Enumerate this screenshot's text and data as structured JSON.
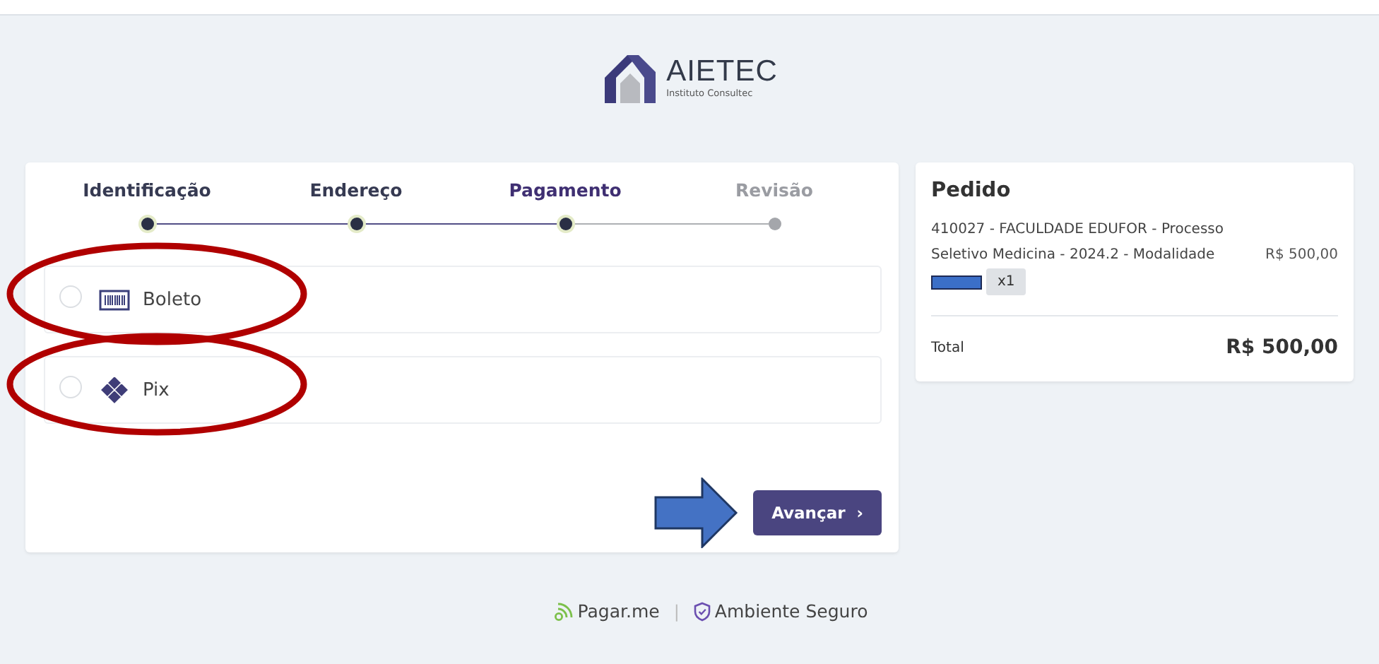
{
  "logo": {
    "name": "AIETEC",
    "tagline": "Instituto Consultec"
  },
  "steps": [
    {
      "label": "Identificação",
      "completed": true,
      "selected": false
    },
    {
      "label": "Endereço",
      "completed": true,
      "selected": false
    },
    {
      "label": "Pagamento",
      "completed": false,
      "selected": true
    },
    {
      "label": "Revisão",
      "completed": false,
      "selected": false
    }
  ],
  "payment_options": [
    {
      "label": "Boleto",
      "kind": "barcode",
      "selected": false,
      "circled": true
    },
    {
      "label": "Pix",
      "kind": "pix",
      "selected": false,
      "circled": true
    }
  ],
  "next_button": {
    "label": "Avançar",
    "chevron": "›",
    "arrow_pointer": true
  },
  "order": {
    "title": "Pedido",
    "items": [
      {
        "line1": "410027 - FACULDADE EDUFOR - Processo",
        "line2": "Seletivo Medicina - 2024.2 - Modalidade",
        "price": "R$ 500,00",
        "quantity": "x1",
        "redacted": true
      }
    ],
    "total_label": "Total",
    "total": "R$ 500,00"
  },
  "footer": {
    "provider": "Pagar.me",
    "separator": "|",
    "secure": "Ambiente Seguro"
  }
}
